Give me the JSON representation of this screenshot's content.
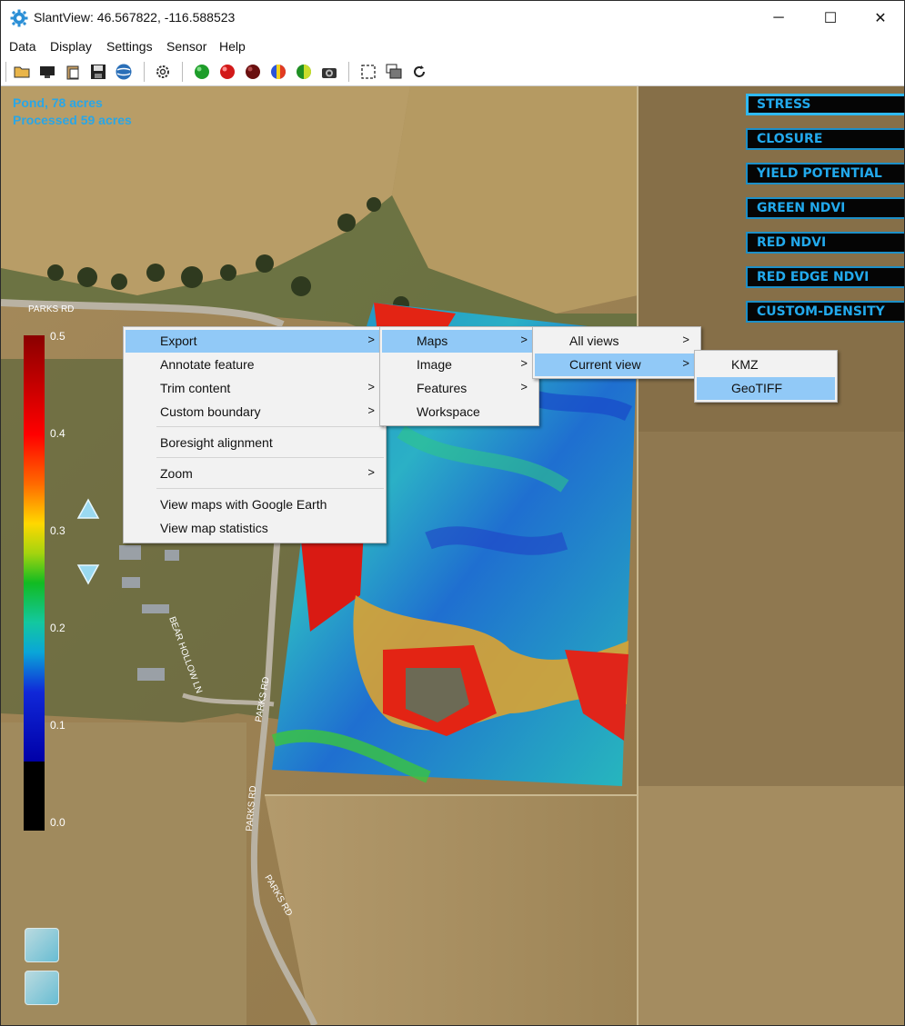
{
  "window": {
    "title": "SlantView: 46.567822, -116.588523",
    "controls": [
      "─",
      "☐",
      "✕"
    ]
  },
  "menubar": [
    "Data",
    "Display",
    "Settings",
    "Sensor",
    "Help"
  ],
  "toolbar_icons": [
    "open-folder-icon",
    "screen-icon",
    "clipboard-icon",
    "save-icon",
    "globe-icon",
    "gear-icon",
    "green-circle-icon",
    "red-circle-icon",
    "dark-red-circle-icon",
    "multicolor-circle-icon",
    "green-yellow-circle-icon",
    "camera-icon",
    "selection-icon",
    "layers-icon",
    "refresh-icon"
  ],
  "map": {
    "info": [
      "Pond, 78 acres",
      "Processed 59 acres"
    ],
    "road_labels": [
      "PARKS RD",
      "PARKS RD",
      "PARKS RD",
      "PARKS RD",
      "BEAR HOLLOW LN"
    ],
    "layers": [
      {
        "label": "STRESS",
        "active": true
      },
      {
        "label": "CLOSURE",
        "active": false
      },
      {
        "label": "YIELD POTENTIAL",
        "active": false
      },
      {
        "label": "GREEN NDVI",
        "active": false
      },
      {
        "label": "RED NDVI",
        "active": false
      },
      {
        "label": "RED EDGE NDVI",
        "active": false
      },
      {
        "label": "CUSTOM-DENSITY",
        "active": false
      }
    ],
    "colorbar_labels": [
      "0.5",
      "0.4",
      "0.3",
      "0.2",
      "0.1",
      "0.0"
    ]
  },
  "context_menu": {
    "items": [
      "Export",
      "Annotate feature",
      "Trim content",
      "Custom boundary",
      "Boresight alignment",
      "Zoom",
      "View maps with Google Earth",
      "View map statistics"
    ],
    "export_submenu": [
      "Maps",
      "Image",
      "Features",
      "Workspace"
    ],
    "maps_submenu": [
      "All views",
      "Current view"
    ],
    "current_view_submenu": [
      "KMZ",
      "GeoTIFF"
    ]
  }
}
